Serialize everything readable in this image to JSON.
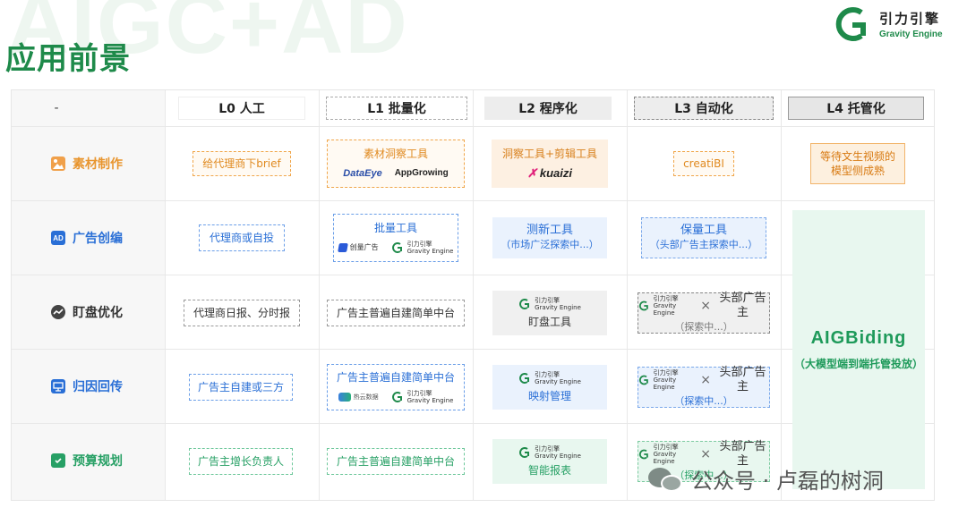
{
  "watermark": "AIGC+AD",
  "page_title": "应用前景",
  "logo": {
    "cn": "引力引擎",
    "en": "Gravity Engine",
    "brand_color": "#1e8a4a"
  },
  "header": {
    "dash": "-",
    "levels": [
      "L0  人工",
      "L1  批量化",
      "L2  程序化",
      "L3  自动化",
      "L4  托管化"
    ]
  },
  "rows": [
    {
      "label": "素材制作",
      "color": "#e8952e",
      "icon": "image-icon"
    },
    {
      "label": "广告创编",
      "color": "#2a6fd6",
      "icon": "ad-icon"
    },
    {
      "label": "盯盘优化",
      "color": "#333333",
      "icon": "trend-icon"
    },
    {
      "label": "归因回传",
      "color": "#2a6fd6",
      "icon": "monitor-icon"
    },
    {
      "label": "预算规划",
      "color": "#27a065",
      "icon": "clipboard-icon"
    }
  ],
  "cells": {
    "r1_l0": "给代理商下brief",
    "r1_l1": {
      "title": "素材洞察工具",
      "brand_a": "DataEye",
      "brand_b": "AppGrowing"
    },
    "r1_l2": {
      "title": "洞察工具+剪辑工具",
      "brand": "kuaizi"
    },
    "r1_l3": "creatiBI",
    "r1_l4": {
      "line1": "等待文生视频的",
      "line2": "模型侧成熟"
    },
    "r2_l0": "代理商或自投",
    "r2_l1": {
      "title": "批量工具",
      "brand_a": "创量广告",
      "brand_b_cn": "引力引擎",
      "brand_b_en": "Gravity Engine"
    },
    "r2_l2": {
      "title": "测新工具",
      "sub": "（市场广泛探索中...）"
    },
    "r2_l3": {
      "title": "保量工具",
      "sub": "（头部广告主探索中...）"
    },
    "r3_l0": "代理商日报、分时报",
    "r3_l1": "广告主普遍自建简单中台",
    "r3_l2": {
      "brand_cn": "引力引擎",
      "brand_en": "Gravity Engine",
      "title": "盯盘工具"
    },
    "r3_l3": {
      "brand_cn": "引力引擎",
      "brand_en": "Gravity Engine",
      "times": "×",
      "partner": "头部广告主",
      "sub": "（探索中...）"
    },
    "r4_l0": "广告主自建或三方",
    "r4_l1": {
      "title": "广告主普遍自建简单中台",
      "brand_a": "热云数据",
      "brand_b_cn": "引力引擎",
      "brand_b_en": "Gravity Engine"
    },
    "r4_l2": {
      "brand_cn": "引力引擎",
      "brand_en": "Gravity Engine",
      "title": "映射管理"
    },
    "r4_l3": {
      "brand_cn": "引力引擎",
      "brand_en": "Gravity Engine",
      "times": "×",
      "partner": "头部广告主",
      "sub": "（探索中...）"
    },
    "r5_l0": "广告主增长负责人",
    "r5_l1": "广告主普遍自建简单中台",
    "r5_l2": {
      "brand_cn": "引力引擎",
      "brand_en": "Gravity Engine",
      "title": "智能报表"
    },
    "r5_l3": {
      "brand_cn": "引力引擎",
      "brand_en": "Gravity Engine",
      "times": "×",
      "partner": "头部广告主",
      "sub": "（探索中...）"
    }
  },
  "aig": {
    "title": "AIGBiding",
    "sub": "（大模型端到端托管投放）"
  },
  "wechat_watermark": "公众号 · 卢磊的树洞"
}
